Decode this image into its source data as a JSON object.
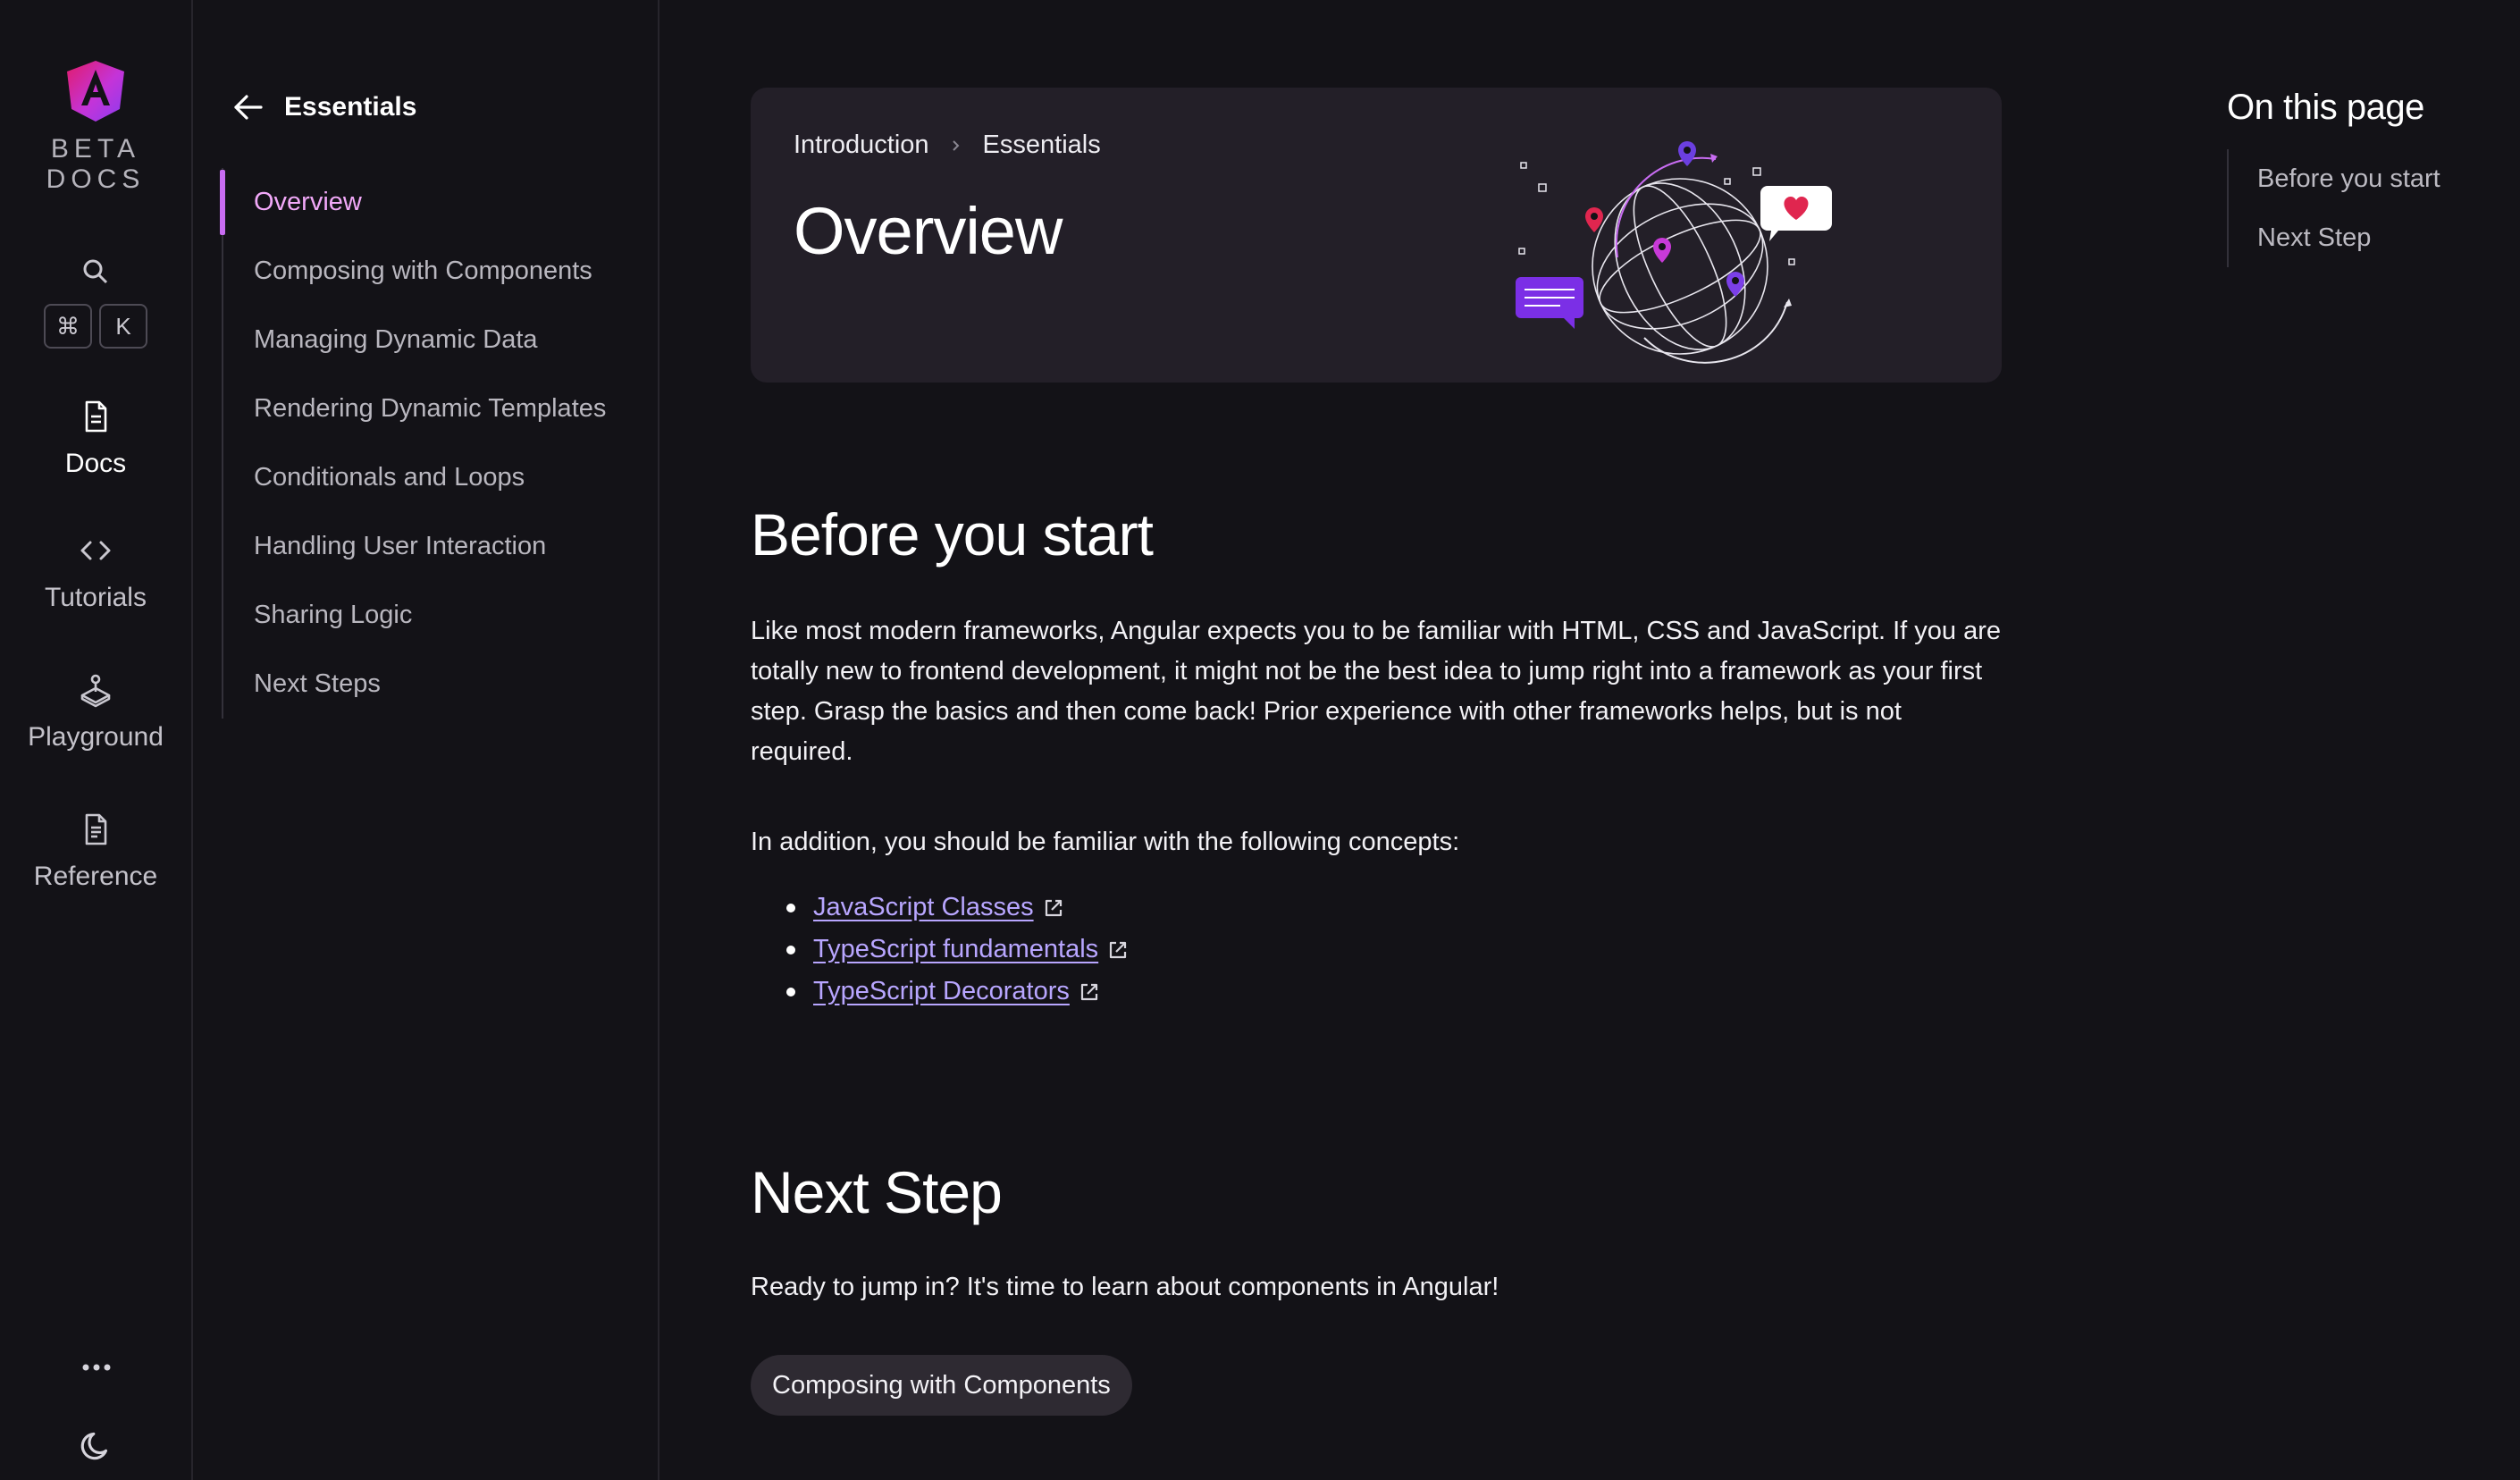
{
  "rail": {
    "brand_line1": "BETA",
    "brand_line2": "DOCS",
    "kbd_cmd": "⌘",
    "kbd_k": "K",
    "items": [
      {
        "label": "Docs",
        "icon": "document-icon"
      },
      {
        "label": "Tutorials",
        "icon": "code-icon"
      },
      {
        "label": "Playground",
        "icon": "joystick-icon"
      },
      {
        "label": "Reference",
        "icon": "reference-icon"
      }
    ]
  },
  "subnav": {
    "title": "Essentials",
    "items": [
      "Overview",
      "Composing with Components",
      "Managing Dynamic Data",
      "Rendering Dynamic Templates",
      "Conditionals and Loops",
      "Handling User Interaction",
      "Sharing Logic",
      "Next Steps"
    ]
  },
  "hero": {
    "crumb1": "Introduction",
    "crumb2": "Essentials",
    "title": "Overview"
  },
  "before": {
    "heading": "Before you start",
    "para1": "Like most modern frameworks, Angular expects you to be familiar with HTML, CSS and JavaScript. If you are totally new to frontend development, it might not be the best idea to jump right into a framework as your first step. Grasp the basics and then come back! Prior experience with other frameworks helps, but is not required.",
    "para2": "In addition, you should be familiar with the following concepts:",
    "links": [
      "JavaScript Classes",
      "TypeScript fundamentals",
      "TypeScript Decorators"
    ]
  },
  "next": {
    "heading": "Next Step",
    "para": "Ready to jump in? It's time to learn about components in Angular!",
    "button": "Composing with Components"
  },
  "toc": {
    "title": "On this page",
    "items": [
      "Before you start",
      "Next Step"
    ]
  },
  "colors": {
    "background": "#131217",
    "accent": "#c86cf2",
    "link": "#b8a6ff"
  }
}
